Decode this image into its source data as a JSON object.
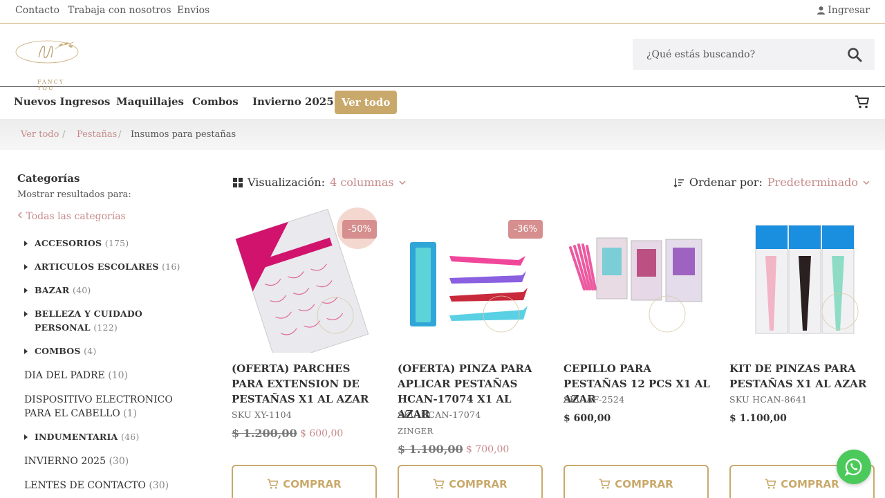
{
  "topbar": {
    "links": [
      "Contacto",
      "Trabaja con nosotros",
      "Envios"
    ],
    "login": "Ingresar"
  },
  "header": {
    "logo_text": "FANCY YOU",
    "search_placeholder": "¿Qué estás buscando?"
  },
  "nav": {
    "items": [
      "Nuevos Ingresos",
      "Maquillajes",
      "Combos",
      "Invierno 2025"
    ],
    "cta": "Ver todo"
  },
  "breadcrumb": [
    "Ver todo",
    "Pestañas",
    "Insumos para pestañas"
  ],
  "sidebar": {
    "title": "Categorías",
    "subtitle": "Mostrar resultados para:",
    "all": "Todas las categorías",
    "categories": [
      {
        "name": "ACCESORIOS",
        "count": "(175)"
      },
      {
        "name": "ARTICULOS ESCOLARES",
        "count": "(16)"
      },
      {
        "name": "BAZAR",
        "count": "(40)"
      },
      {
        "name": "BELLEZA Y CUIDADO PERSONAL",
        "count": "(122)"
      },
      {
        "name": "COMBOS",
        "count": "(4)"
      },
      {
        "name": "DIA DEL PADRE",
        "count": "(10)"
      },
      {
        "name": "DISPOSITIVO ELECTRONICO PARA EL CABELLO",
        "count": "(1)"
      },
      {
        "name": "INDUMENTARIA",
        "count": "(46)"
      },
      {
        "name": "INVIERNO 2025",
        "count": "(30)"
      },
      {
        "name": "LENTES DE CONTACTO",
        "count": "(30)"
      }
    ]
  },
  "toolbar": {
    "view_label": "Visualización:",
    "view_value": "4 columnas",
    "order_label": "Ordenar por:",
    "order_value": "Predeterminado"
  },
  "products": [
    {
      "name": "(OFERTA) PARCHES PARA EXTENSION DE PESTAÑAS X1 AL AZAR",
      "sku": "SKU XY-1104",
      "badge": "-50%",
      "old_price": "$ 1.200,00",
      "price": "$ 600,00"
    },
    {
      "name": "(OFERTA) PINZA PARA APLICAR PESTAÑAS HCAN-17074 X1 AL AZAR",
      "sku": "SKU HCAN-17074",
      "brand": "ZINGER",
      "badge": "-36%",
      "old_price": "$ 1.100,00",
      "price": "$ 700,00"
    },
    {
      "name": "CEPILLO PARA PESTAÑAS 12 PCS X1 AL AZAR",
      "sku": "SKU AF-2524",
      "price": "$ 600,00"
    },
    {
      "name": "KIT DE PINZAS PARA PESTAÑAS X1 AL AZAR",
      "sku": "SKU HCAN-8641",
      "price": "$ 1.100,00"
    }
  ],
  "buy_label": "COMPRAR",
  "colors": {
    "gold": "#c9a96b",
    "rose": "#c68a8a",
    "whatsapp": "#4cc95b"
  },
  "icons": [
    "user-icon",
    "search-icon",
    "cart-icon",
    "grid-icon",
    "sort-icon",
    "chevron-down-icon",
    "chevron-left-icon",
    "whatsapp-icon"
  ]
}
